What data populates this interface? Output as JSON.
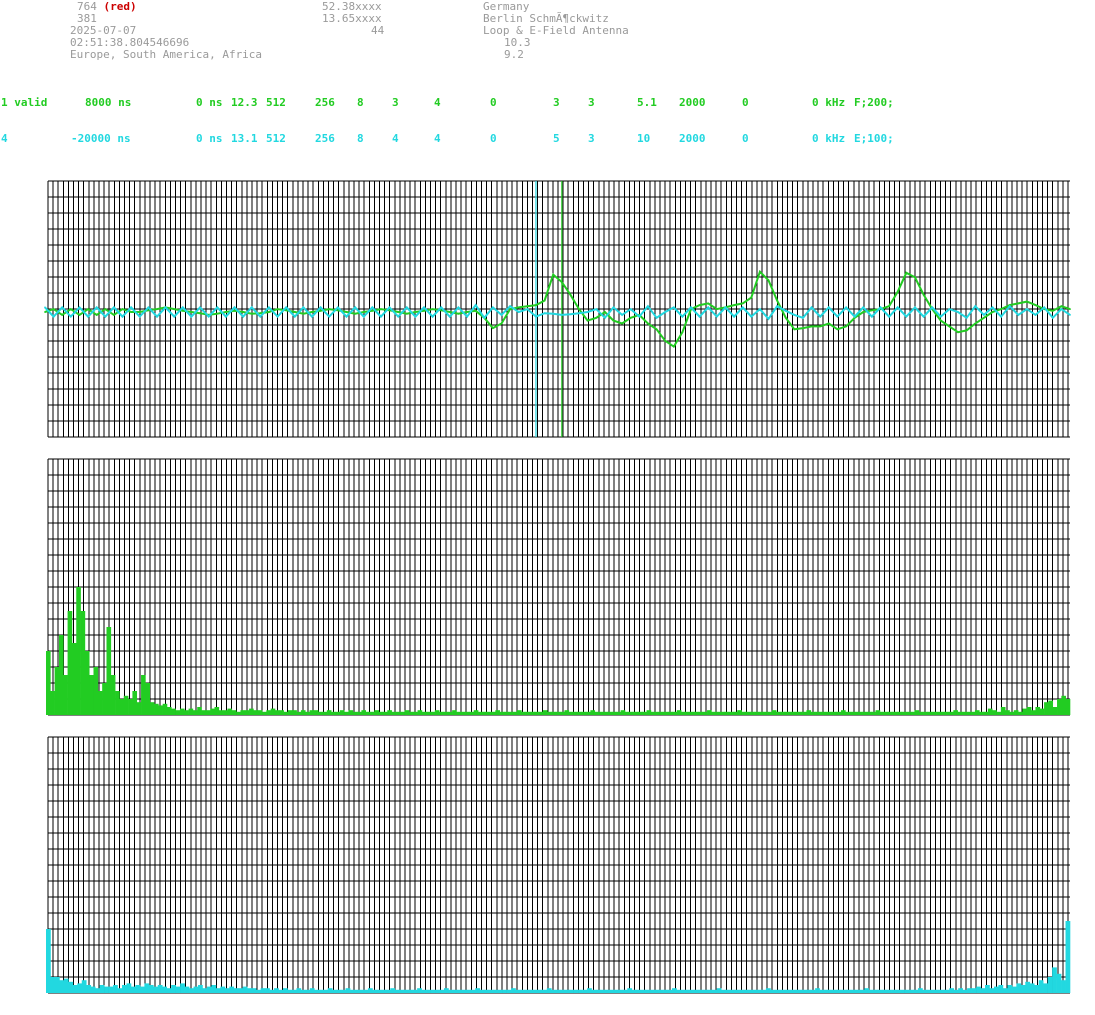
{
  "header": {
    "id_line": "764",
    "id_tag": "(red)",
    "number": "381",
    "date": "2025-07-07",
    "time": "02:51:38.804546696",
    "regions": "Europe, South America, Africa",
    "lat": "52.38xxxx",
    "lon": "13.65xxxx",
    "alt": "44",
    "country": "Germany",
    "location": "Berlin SchmÃ¶ckwitz",
    "antenna": "Loop & E-Field Antenna",
    "val1": "10.3",
    "val2": "9.2"
  },
  "channels": [
    {
      "c0": "1 valid",
      "c1": "8000 ns",
      "c2": "0 ns",
      "c3": "12.3",
      "c4": "512",
      "c5": "256",
      "c6": "8",
      "c7": "3",
      "c8": "4",
      "c9": "0",
      "c10": "3",
      "c11": "3",
      "c12": "5.1",
      "c13": "2000",
      "c14": "0",
      "c15": "0 kHz",
      "c16": "F;200;"
    },
    {
      "c0": "4",
      "c1": "-20000 ns",
      "c2": "0 ns",
      "c3": "13.1",
      "c4": "512",
      "c5": "256",
      "c6": "8",
      "c7": "4",
      "c8": "4",
      "c9": "0",
      "c10": "5",
      "c11": "3",
      "c12": "10",
      "c13": "2000",
      "c14": "0",
      "c15": "0 kHz",
      "c16": "E;100;"
    }
  ],
  "colors": {
    "green": "#22cc22",
    "cyan": "#22d8e0",
    "grid": "#000000",
    "header_gray": "#9a9a9a",
    "red": "#cc0000"
  },
  "chart_data": [
    {
      "type": "line",
      "title": "",
      "xlabel": "",
      "ylabel": "",
      "ylim": [
        -1,
        1
      ],
      "x_count": 120,
      "markers": [
        {
          "color": "cyan",
          "x": 57
        },
        {
          "color": "green",
          "x": 60
        }
      ],
      "series": [
        {
          "color": "green",
          "values": [
            0,
            0.05,
            -0.05,
            0.05,
            -0.05,
            0.05,
            -0.05,
            0.05,
            -0.05,
            0.05,
            0,
            0,
            0.03,
            0.05,
            0.08,
            0.05,
            0.02,
            0,
            -0.02,
            -0.05,
            -0.03,
            0,
            0.02,
            0,
            -0.03,
            -0.02,
            0,
            0.05,
            0.03,
            0,
            -0.03,
            0,
            0.02,
            0.05,
            0.03,
            0,
            -0.03,
            0,
            0.02,
            0.05,
            0.03,
            0,
            -0.03,
            0,
            0.02,
            0.05,
            0.03,
            0,
            -0.03,
            0,
            0.02,
            -0.1,
            -0.28,
            -0.2,
            0.05,
            0.08,
            0.1,
            0.12,
            0.2,
            0.65,
            0.52,
            0.3,
            0.05,
            -0.15,
            -0.1,
            0,
            -0.15,
            -0.2,
            -0.1,
            -0.05,
            -0.2,
            -0.3,
            -0.5,
            -0.6,
            -0.35,
            0.05,
            0.12,
            0.15,
            0.05,
            0.08,
            0.12,
            0.15,
            0.25,
            0.7,
            0.55,
            0.2,
            -0.1,
            -0.3,
            -0.28,
            -0.25,
            -0.25,
            -0.2,
            -0.3,
            -0.25,
            -0.1,
            0,
            0.03,
            0.05,
            0.1,
            0.35,
            0.68,
            0.6,
            0.3,
            0.05,
            -0.15,
            -0.25,
            -0.35,
            -0.32,
            -0.2,
            -0.1,
            0,
            0.05,
            0.12,
            0.15,
            0.18,
            0.12,
            0.05,
            0.02,
            0.1,
            0.05
          ]
        },
        {
          "color": "cyan",
          "values": [
            0.08,
            -0.08,
            0.08,
            -0.08,
            0.08,
            -0.08,
            0.08,
            -0.08,
            0.08,
            -0.08,
            0.08,
            -0.08,
            0.08,
            -0.08,
            0.08,
            -0.08,
            0.08,
            -0.08,
            0.08,
            -0.08,
            0.08,
            -0.08,
            0.08,
            -0.08,
            0.08,
            -0.08,
            0.08,
            -0.08,
            0.08,
            -0.08,
            0.08,
            -0.08,
            0.08,
            -0.08,
            0.08,
            -0.08,
            0.08,
            -0.08,
            0.08,
            -0.08,
            0.08,
            -0.08,
            0.08,
            -0.08,
            0.08,
            -0.08,
            0.08,
            -0.08,
            0.08,
            -0.08,
            0.12,
            -0.1,
            0.08,
            -0.05,
            0.1,
            0,
            0.05,
            -0.08,
            -0.02,
            -0.03,
            -0.05,
            -0.04,
            -0.02,
            0,
            0.05,
            -0.1,
            0.08,
            -0.05,
            0.05,
            -0.08,
            0.1,
            -0.1,
            0,
            0.08,
            -0.08,
            0.08,
            -0.08,
            0.08,
            -0.08,
            0.08,
            -0.08,
            0.08,
            -0.08,
            0.05,
            -0.12,
            0.1,
            0.02,
            -0.05,
            -0.1,
            0.08,
            -0.08,
            0.08,
            -0.08,
            0.08,
            -0.08,
            0.08,
            -0.08,
            0.08,
            -0.08,
            0.08,
            -0.08,
            0.08,
            -0.08,
            0.08,
            -0.08,
            0.05,
            0,
            -0.1,
            0.1,
            -0.05,
            0.08,
            -0.08,
            0.1,
            -0.05,
            0.05,
            -0.05,
            0.08,
            -0.1,
            0.05,
            -0.05
          ]
        }
      ]
    },
    {
      "type": "bar",
      "title": "",
      "xlabel": "",
      "ylabel": "",
      "ylim": [
        0,
        16
      ],
      "color": "green",
      "values": [
        4,
        1.5,
        3,
        5,
        2.5,
        6.5,
        4.5,
        8,
        6.5,
        4,
        2.5,
        3,
        1.5,
        2,
        5.5,
        2.5,
        1.5,
        1,
        1.2,
        1,
        1.5,
        0.8,
        2.5,
        2,
        0.8,
        0.7,
        0.6,
        0.7,
        0.5,
        0.4,
        0.3,
        0.4,
        0.3,
        0.4,
        0.3,
        0.5,
        0.3,
        0.3,
        0.4,
        0.5,
        0.3,
        0.3,
        0.4,
        0.3,
        0.2,
        0.3,
        0.3,
        0.4,
        0.3,
        0.3,
        0.2,
        0.3,
        0.4,
        0.3,
        0.3,
        0.2,
        0.3,
        0.3,
        0.2,
        0.3,
        0.2,
        0.3,
        0.3,
        0.2,
        0.2,
        0.3,
        0.2,
        0.2,
        0.3,
        0.2,
        0.3,
        0.2,
        0.2,
        0.3,
        0.2,
        0.2,
        0.3,
        0.2,
        0.2,
        0.3,
        0.2,
        0.2,
        0.2,
        0.3,
        0.2,
        0.2,
        0.3,
        0.2,
        0.2,
        0.2,
        0.3,
        0.2,
        0.2,
        0.2,
        0.3,
        0.2,
        0.2,
        0.2,
        0.2,
        0.3,
        0.2,
        0.2,
        0.2,
        0.2,
        0.3,
        0.2,
        0.2,
        0.2,
        0.2,
        0.3,
        0.2,
        0.2,
        0.2,
        0.2,
        0.2,
        0.3,
        0.2,
        0.2,
        0.2,
        0.2,
        0.3,
        0.2,
        0.2,
        0.2,
        0.2,
        0.2,
        0.3,
        0.2,
        0.2,
        0.2,
        0.2,
        0.2,
        0.2,
        0.3,
        0.2,
        0.2,
        0.2,
        0.2,
        0.2,
        0.3,
        0.2,
        0.2,
        0.2,
        0.2,
        0.2,
        0.2,
        0.3,
        0.2,
        0.2,
        0.2,
        0.2,
        0.2,
        0.2,
        0.3,
        0.2,
        0.2,
        0.2,
        0.2,
        0.2,
        0.2,
        0.3,
        0.2,
        0.2,
        0.2,
        0.2,
        0.2,
        0.2,
        0.2,
        0.3,
        0.2,
        0.2,
        0.2,
        0.2,
        0.2,
        0.2,
        0.2,
        0.3,
        0.2,
        0.2,
        0.2,
        0.2,
        0.2,
        0.2,
        0.2,
        0.3,
        0.2,
        0.2,
        0.2,
        0.2,
        0.2,
        0.2,
        0.2,
        0.3,
        0.2,
        0.2,
        0.2,
        0.2,
        0.2,
        0.2,
        0.2,
        0.2,
        0.3,
        0.2,
        0.2,
        0.2,
        0.2,
        0.2,
        0.2,
        0.2,
        0.2,
        0.3,
        0.2,
        0.2,
        0.2,
        0.2,
        0.3,
        0.2,
        0.2,
        0.4,
        0.3,
        0.2,
        0.5,
        0.3,
        0.2,
        0.3,
        0.2,
        0.4,
        0.5,
        0.3,
        0.5,
        0.4,
        0.8,
        0.9,
        0.5,
        1,
        1.2,
        1
      ]
    },
    {
      "type": "bar",
      "title": "",
      "xlabel": "",
      "ylabel": "",
      "ylim": [
        0,
        16
      ],
      "color": "cyan",
      "values": [
        4,
        1,
        1,
        0.8,
        0.9,
        0.7,
        0.5,
        0.6,
        0.8,
        0.5,
        0.4,
        0.3,
        0.5,
        0.4,
        0.4,
        0.5,
        0.3,
        0.5,
        0.6,
        0.4,
        0.5,
        0.4,
        0.6,
        0.5,
        0.4,
        0.5,
        0.4,
        0.3,
        0.5,
        0.4,
        0.6,
        0.4,
        0.3,
        0.4,
        0.5,
        0.3,
        0.4,
        0.5,
        0.3,
        0.4,
        0.3,
        0.4,
        0.3,
        0.3,
        0.4,
        0.3,
        0.3,
        0.2,
        0.3,
        0.3,
        0.2,
        0.3,
        0.2,
        0.3,
        0.2,
        0.2,
        0.3,
        0.2,
        0.2,
        0.3,
        0.2,
        0.2,
        0.2,
        0.3,
        0.2,
        0.2,
        0.2,
        0.3,
        0.2,
        0.2,
        0.2,
        0.2,
        0.3,
        0.2,
        0.2,
        0.2,
        0.2,
        0.3,
        0.2,
        0.2,
        0.2,
        0.2,
        0.2,
        0.3,
        0.2,
        0.2,
        0.2,
        0.2,
        0.2,
        0.3,
        0.2,
        0.2,
        0.2,
        0.2,
        0.2,
        0.2,
        0.3,
        0.2,
        0.2,
        0.2,
        0.2,
        0.2,
        0.2,
        0.2,
        0.3,
        0.2,
        0.2,
        0.2,
        0.2,
        0.2,
        0.2,
        0.2,
        0.3,
        0.2,
        0.2,
        0.2,
        0.2,
        0.2,
        0.2,
        0.2,
        0.2,
        0.3,
        0.2,
        0.2,
        0.2,
        0.2,
        0.2,
        0.2,
        0.2,
        0.2,
        0.3,
        0.2,
        0.2,
        0.2,
        0.2,
        0.2,
        0.2,
        0.2,
        0.2,
        0.2,
        0.3,
        0.2,
        0.2,
        0.2,
        0.2,
        0.2,
        0.2,
        0.2,
        0.2,
        0.2,
        0.3,
        0.2,
        0.2,
        0.2,
        0.2,
        0.2,
        0.2,
        0.2,
        0.2,
        0.2,
        0.2,
        0.3,
        0.2,
        0.2,
        0.2,
        0.2,
        0.2,
        0.2,
        0.2,
        0.2,
        0.2,
        0.2,
        0.3,
        0.2,
        0.2,
        0.2,
        0.2,
        0.2,
        0.2,
        0.2,
        0.2,
        0.2,
        0.2,
        0.3,
        0.2,
        0.2,
        0.2,
        0.2,
        0.2,
        0.2,
        0.2,
        0.2,
        0.2,
        0.2,
        0.2,
        0.3,
        0.2,
        0.2,
        0.2,
        0.2,
        0.2,
        0.2,
        0.3,
        0.2,
        0.3,
        0.2,
        0.3,
        0.3,
        0.4,
        0.3,
        0.5,
        0.3,
        0.4,
        0.5,
        0.3,
        0.5,
        0.4,
        0.6,
        0.5,
        0.7,
        0.6,
        0.5,
        0.8,
        0.6,
        1,
        1.6,
        1.2,
        0.8,
        4.5
      ]
    }
  ]
}
